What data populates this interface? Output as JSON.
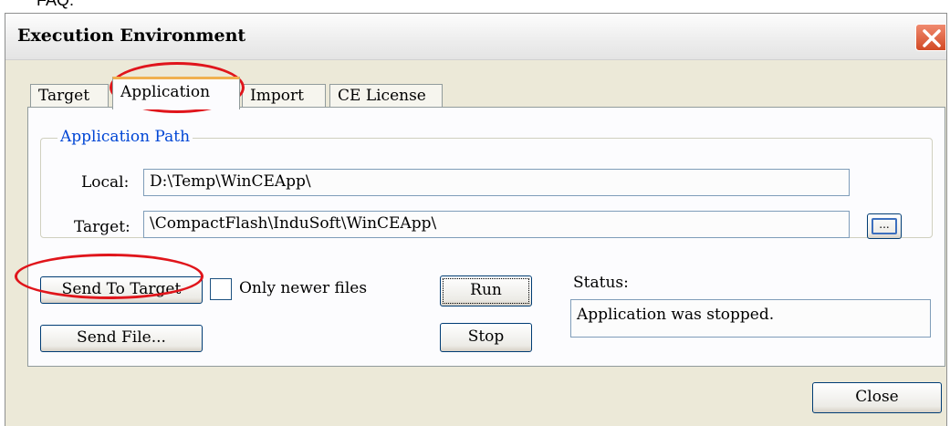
{
  "header_fragment": "FAQ.",
  "window": {
    "title": "Execution Environment",
    "close_icon": "close-icon"
  },
  "tabs": [
    {
      "label": "Target"
    },
    {
      "label": "Application",
      "active": true
    },
    {
      "label": "Import"
    },
    {
      "label": "CE License"
    }
  ],
  "application_path": {
    "legend": "Application Path",
    "local_label": "Local:",
    "local_value": "D:\\Temp\\WinCEApp\\",
    "target_label": "Target:",
    "target_value": "\\CompactFlash\\InduSoft\\WinCEApp\\",
    "browse_label": "..."
  },
  "actions": {
    "send_to_target": "Send To Target",
    "only_newer_files": "Only newer files",
    "send_file": "Send File...",
    "run": "Run",
    "stop": "Stop",
    "status_label": "Status:",
    "status_value": "Application was stopped.",
    "close": "Close"
  },
  "colors": {
    "highlight": "#e0151b",
    "legend": "#0046d5",
    "tab_accent": "#f0b04f"
  }
}
